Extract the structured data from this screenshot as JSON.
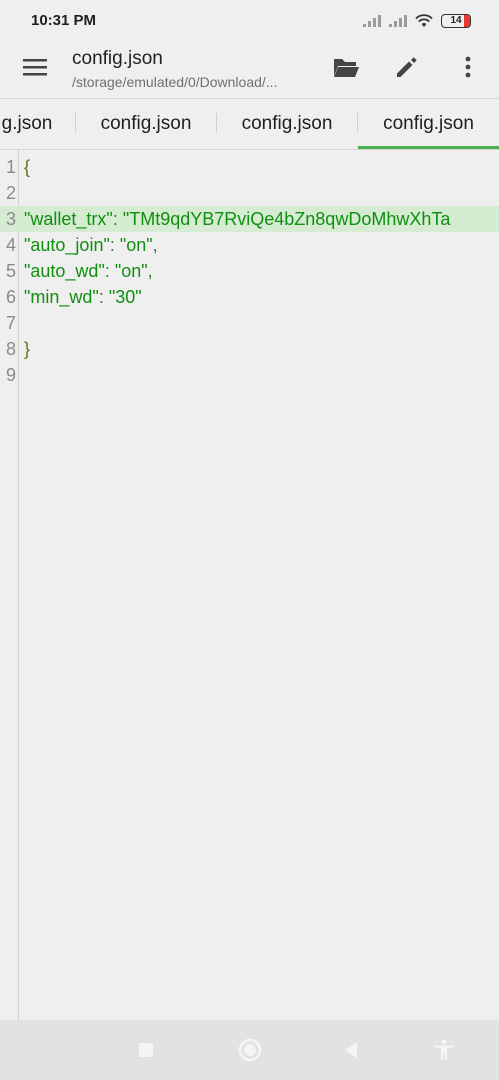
{
  "status_bar": {
    "time": "10:31 PM",
    "battery": "14",
    "icons": [
      "signal-icon",
      "signal-icon",
      "wifi-icon",
      "battery-icon"
    ]
  },
  "app_bar": {
    "title": "config.json",
    "subtitle": "/storage/emulated/0/Download/..."
  },
  "tabs": [
    {
      "label": "g.json"
    },
    {
      "label": "config.json"
    },
    {
      "label": "config.json"
    },
    {
      "label": "config.json"
    }
  ],
  "active_tab_index": 3,
  "accent_color": "#4caf50",
  "editor": {
    "lines": [
      {
        "num": "1",
        "text": "{",
        "kind": "brace"
      },
      {
        "num": "2",
        "text": "",
        "kind": "plain"
      },
      {
        "num": "3",
        "text": " \"wallet_trx\": \"TMt9qdYB7RviQe4bZn8qwDoMhwXhTa",
        "kind": "entry",
        "key": "\"wallet_trx\"",
        "value": "\"TMt9qdYB7RviQe4bZn8qwDoMhwXhTa",
        "trail": "",
        "highlight": true
      },
      {
        "num": "4",
        "text": " \"auto_join\": \"on\",",
        "kind": "entry",
        "key": "\"auto_join\"",
        "value": "\"on\"",
        "trail": ","
      },
      {
        "num": "5",
        "text": " \"auto_wd\": \"on\",",
        "kind": "entry",
        "key": "\"auto_wd\"",
        "value": "\"on\"",
        "trail": ","
      },
      {
        "num": "6",
        "text": " \"min_wd\": \"30\"",
        "kind": "entry",
        "key": "\"min_wd\"",
        "value": "\"30\"",
        "trail": ""
      },
      {
        "num": "7",
        "text": "",
        "kind": "plain"
      },
      {
        "num": "8",
        "text": "}",
        "kind": "brace"
      },
      {
        "num": "9",
        "text": "",
        "kind": "plain"
      }
    ]
  },
  "nav_bar": {
    "buttons": [
      "square-icon",
      "circle-icon",
      "back-triangle-icon",
      "accessibility-icon"
    ]
  }
}
